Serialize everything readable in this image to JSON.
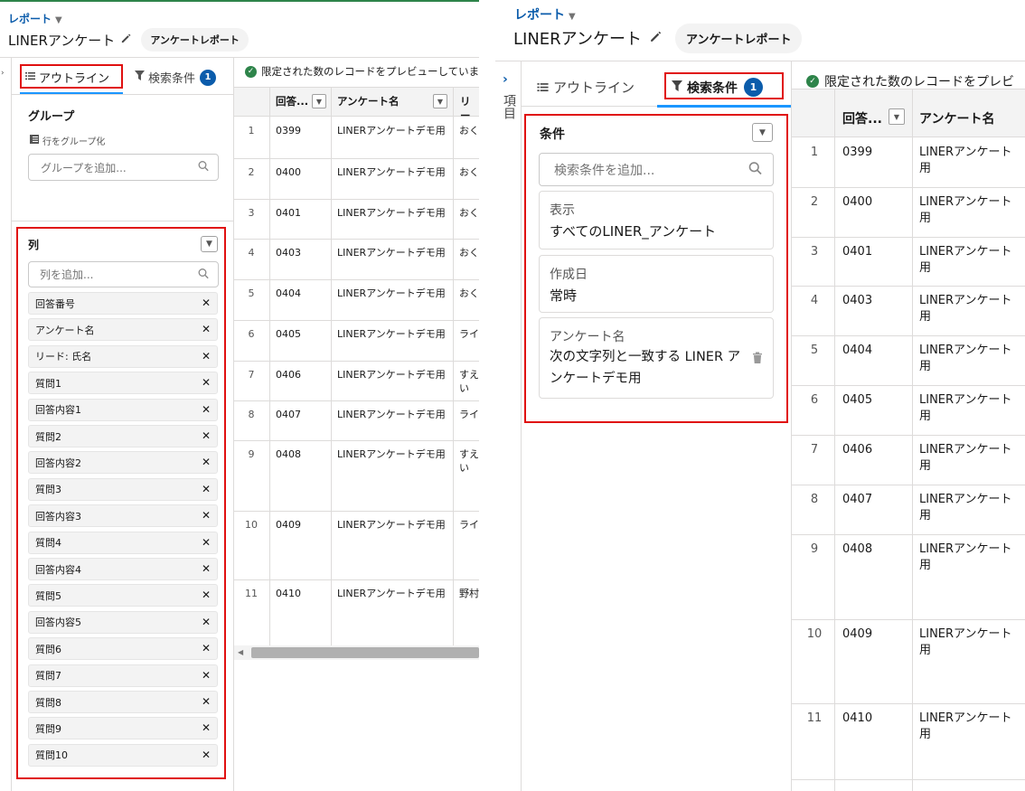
{
  "breadcrumb": "レポート",
  "report_name": "LINERアンケート",
  "report_type": "アンケートレポート",
  "tabs": {
    "outline": "アウトライン",
    "filters": "検索条件",
    "filter_count": "1"
  },
  "group_section": {
    "title": "グループ",
    "row_group_label": "行をグループ化",
    "add_placeholder": "グループを追加..."
  },
  "column_section": {
    "title": "列",
    "add_placeholder": "列を追加...",
    "columns": [
      "回答番号",
      "アンケート名",
      "リード: 氏名",
      "質問1",
      "回答内容1",
      "質問2",
      "回答内容2",
      "質問3",
      "回答内容3",
      "質問4",
      "回答内容4",
      "質問5",
      "回答内容5",
      "質問6",
      "質問7",
      "質問8",
      "質問9",
      "質問10"
    ]
  },
  "preview_notice_left": "限定された数のレコードをプレビューしていま",
  "preview_notice_right": "限定された数のレコードをプレビ",
  "side_label": "項目",
  "grid": {
    "headers": [
      "回答...",
      "アンケート名",
      "リー"
    ],
    "rows": [
      {
        "num": "1",
        "id": "0399",
        "survey": "LINERアンケートデモ用",
        "lead": "おく"
      },
      {
        "num": "2",
        "id": "0400",
        "survey": "LINERアンケートデモ用",
        "lead": "おく"
      },
      {
        "num": "3",
        "id": "0401",
        "survey": "LINERアンケートデモ用",
        "lead": "おく"
      },
      {
        "num": "4",
        "id": "0403",
        "survey": "LINERアンケートデモ用",
        "lead": "おく"
      },
      {
        "num": "5",
        "id": "0404",
        "survey": "LINERアンケートデモ用",
        "lead": "おく"
      },
      {
        "num": "6",
        "id": "0405",
        "survey": "LINERアンケートデモ用",
        "lead": "ライ"
      },
      {
        "num": "7",
        "id": "0406",
        "survey": "LINERアンケートデモ用",
        "lead": "すえい"
      },
      {
        "num": "8",
        "id": "0407",
        "survey": "LINERアンケートデモ用",
        "lead": "ライ"
      },
      {
        "num": "9",
        "id": "0408",
        "survey": "LINERアンケートデモ用",
        "lead": "すえい"
      },
      {
        "num": "10",
        "id": "0409",
        "survey": "LINERアンケートデモ用",
        "lead": "ライ"
      },
      {
        "num": "11",
        "id": "0410",
        "survey": "LINERアンケートデモ用",
        "lead": "野村"
      }
    ],
    "right_survey_text": "LINERアンケート用"
  },
  "filters_panel": {
    "title": "条件",
    "add_placeholder": "検索条件を追加...",
    "cards": [
      {
        "label": "表示",
        "value": "すべてのLINER_アンケート"
      },
      {
        "label": "作成日",
        "value": "常時"
      },
      {
        "label": "アンケート名",
        "value": "次の文字列と一致する LINER アンケートデモ用"
      }
    ]
  }
}
